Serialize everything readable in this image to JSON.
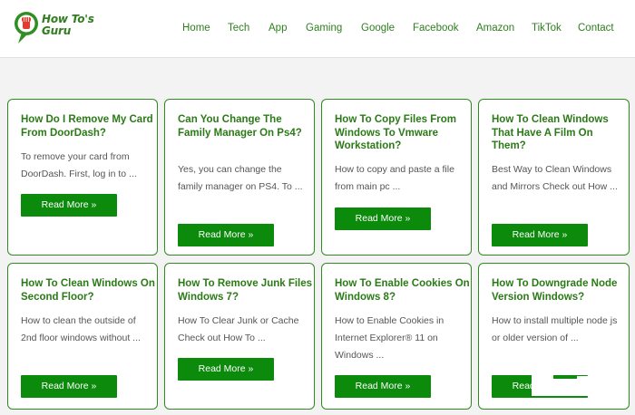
{
  "logo": {
    "line1": "How To's",
    "line2": "Guru",
    "icon": "fist-icon"
  },
  "nav": [
    "Home",
    "Tech",
    "App",
    "Gaming",
    "Google",
    "Facebook",
    "Amazon",
    "TikTok",
    "Contact"
  ],
  "read_more": "Read More »",
  "cards": [
    {
      "title": "How Do I Remove My Card From DoorDash?",
      "excerpt": "To remove your card from DoorDash. First, log in to ..."
    },
    {
      "title": "Can You Change The Family Manager On Ps4?",
      "excerpt": "Yes, you can change the family manager on PS4. To ..."
    },
    {
      "title": "How To Copy Files From Windows To Vmware Workstation?",
      "excerpt": "How to copy and paste a file from main pc ..."
    },
    {
      "title": "How To Clean Windows That Have A Film On Them?",
      "excerpt": "Best Way to Clean Windows and Mirrors Check out How ..."
    },
    {
      "title": "How To Clean Windows On Second Floor?",
      "excerpt": "How to clean the outside of 2nd floor windows without ..."
    },
    {
      "title": "How To Remove Junk Files Windows 7?",
      "excerpt": "How To Clear Junk or Cache Check out How To ..."
    },
    {
      "title": "How To Enable Cookies On Windows 8?",
      "excerpt": "How to Enable Cookies in Internet Explorer® 11 on Windows ..."
    },
    {
      "title": "How To Downgrade Node Version Windows?",
      "excerpt": "How to install multiple node js or older version of ..."
    }
  ]
}
